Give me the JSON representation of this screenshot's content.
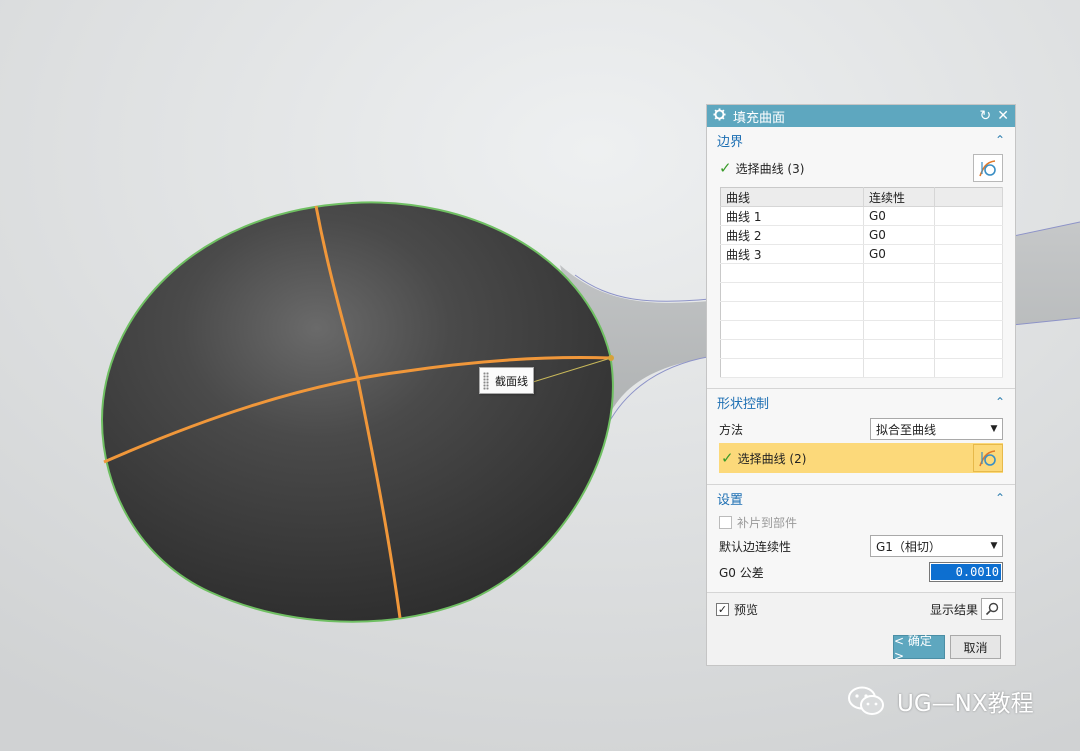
{
  "viewport": {
    "tooltip_label": "截面线",
    "colors": {
      "background": "#d9dbdc",
      "surface": "#3b3b3b",
      "section_curve": "#f0973a",
      "boundary": "#6fbf62"
    }
  },
  "dialog": {
    "title": "填充曲面",
    "title_icons": [
      "gear-icon",
      "reset-icon",
      "close-icon"
    ],
    "accent_color": "#5ea7bf",
    "boundary": {
      "header": "边界",
      "select_label": "选择曲线 (3)",
      "table": {
        "columns": [
          "曲线",
          "连续性"
        ],
        "rows": [
          [
            "曲线 1",
            "G0"
          ],
          [
            "曲线 2",
            "G0"
          ],
          [
            "曲线 3",
            "G0"
          ]
        ]
      }
    },
    "shape_control": {
      "header": "形状控制",
      "method_label": "方法",
      "method_value": "拟合至曲线",
      "select_label": "选择曲线 (2)"
    },
    "settings": {
      "header": "设置",
      "patch_label": "补片到部件",
      "default_continuity_label": "默认边连续性",
      "default_continuity_value": "G1（相切）",
      "tolerance_label": "G0 公差",
      "tolerance_value": "0.0010"
    },
    "preview": {
      "preview_label": "预览",
      "preview_checked": true,
      "show_result_label": "显示结果"
    },
    "buttons": {
      "ok": "< 确定 >",
      "cancel": "取消"
    }
  },
  "watermark": {
    "text": "UG—NX教程"
  }
}
